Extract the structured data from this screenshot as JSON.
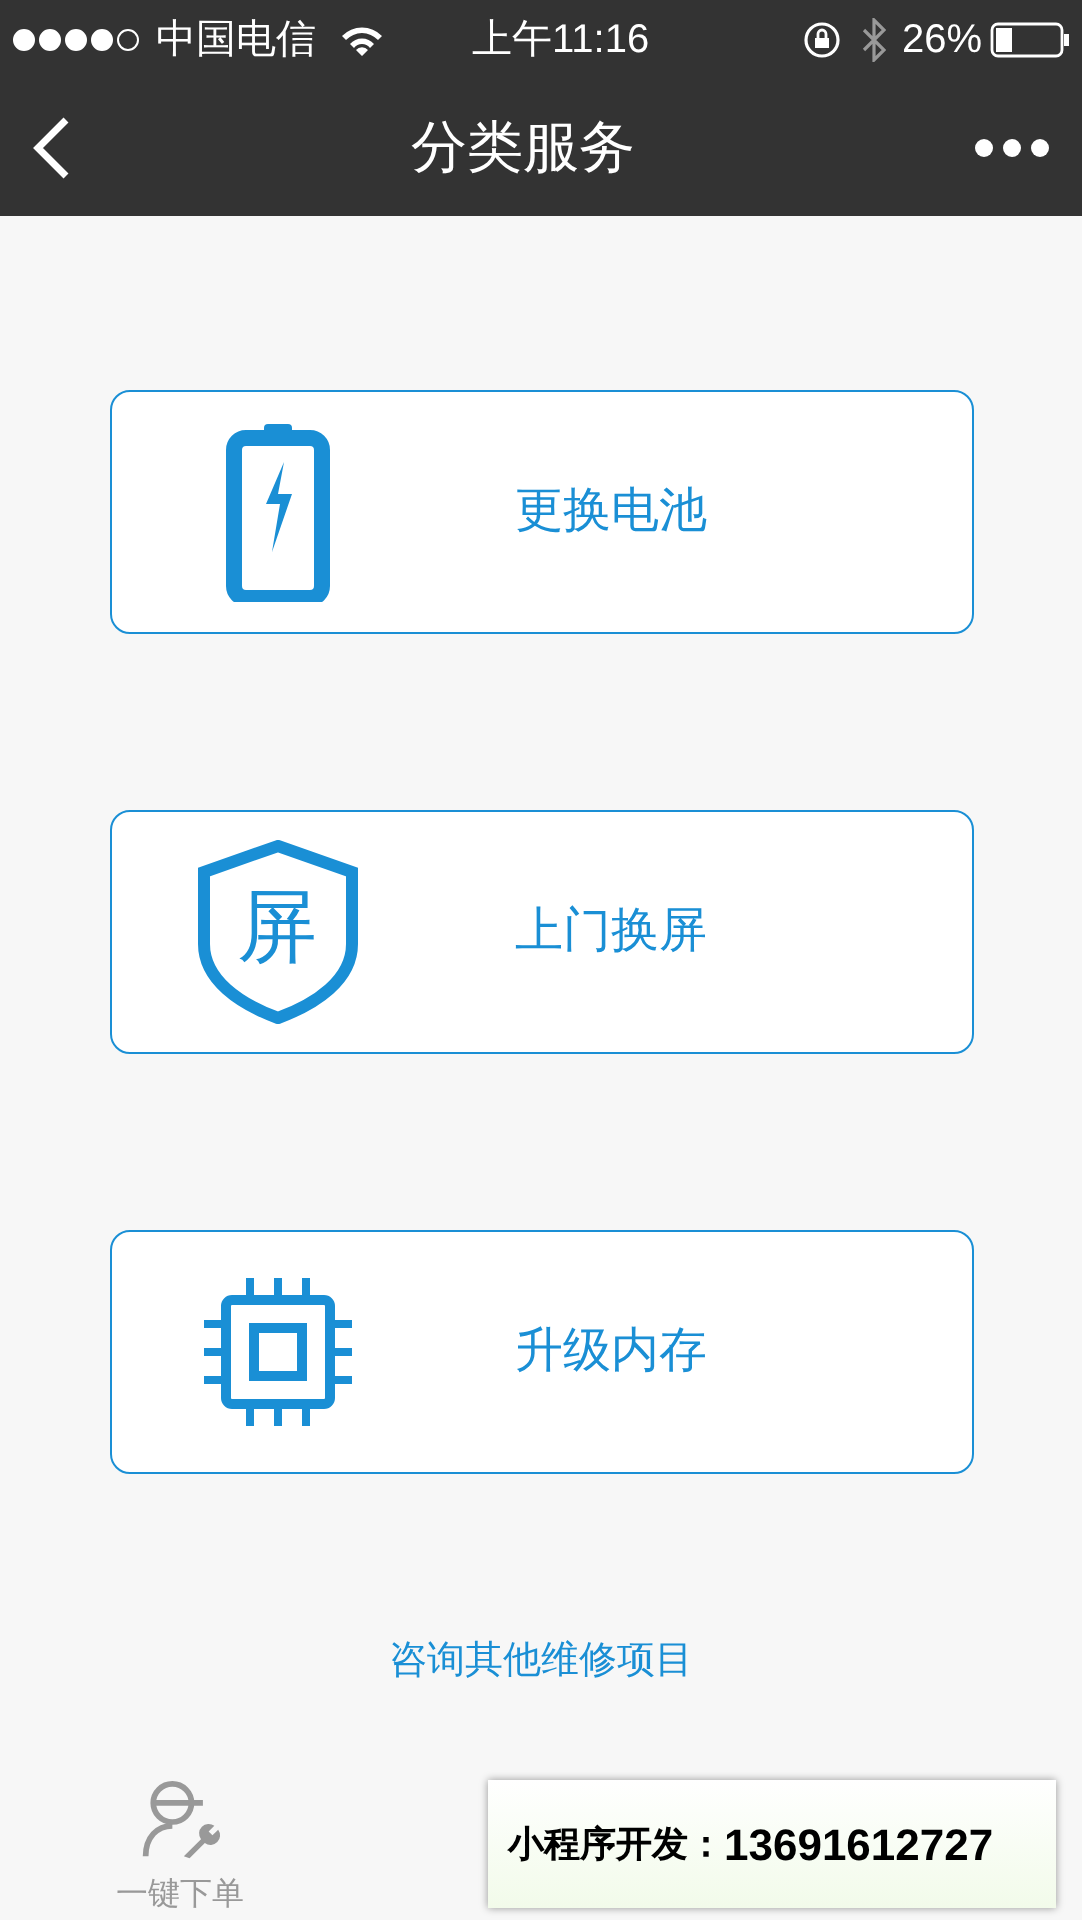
{
  "status_bar": {
    "carrier": "中国电信",
    "time": "上午11:16",
    "battery": "26%"
  },
  "nav": {
    "title": "分类服务"
  },
  "services": [
    {
      "kind": "battery",
      "label": "更换电池"
    },
    {
      "kind": "shield",
      "icon_text": "屏",
      "label": "上门换屏"
    },
    {
      "kind": "chip",
      "label": "升级内存"
    }
  ],
  "consult_link": "咨询其他维修项目",
  "tab_bar": [
    {
      "label": "一键下单"
    }
  ],
  "overlay": {
    "label": "小程序开发：",
    "phone": "13691612727"
  }
}
